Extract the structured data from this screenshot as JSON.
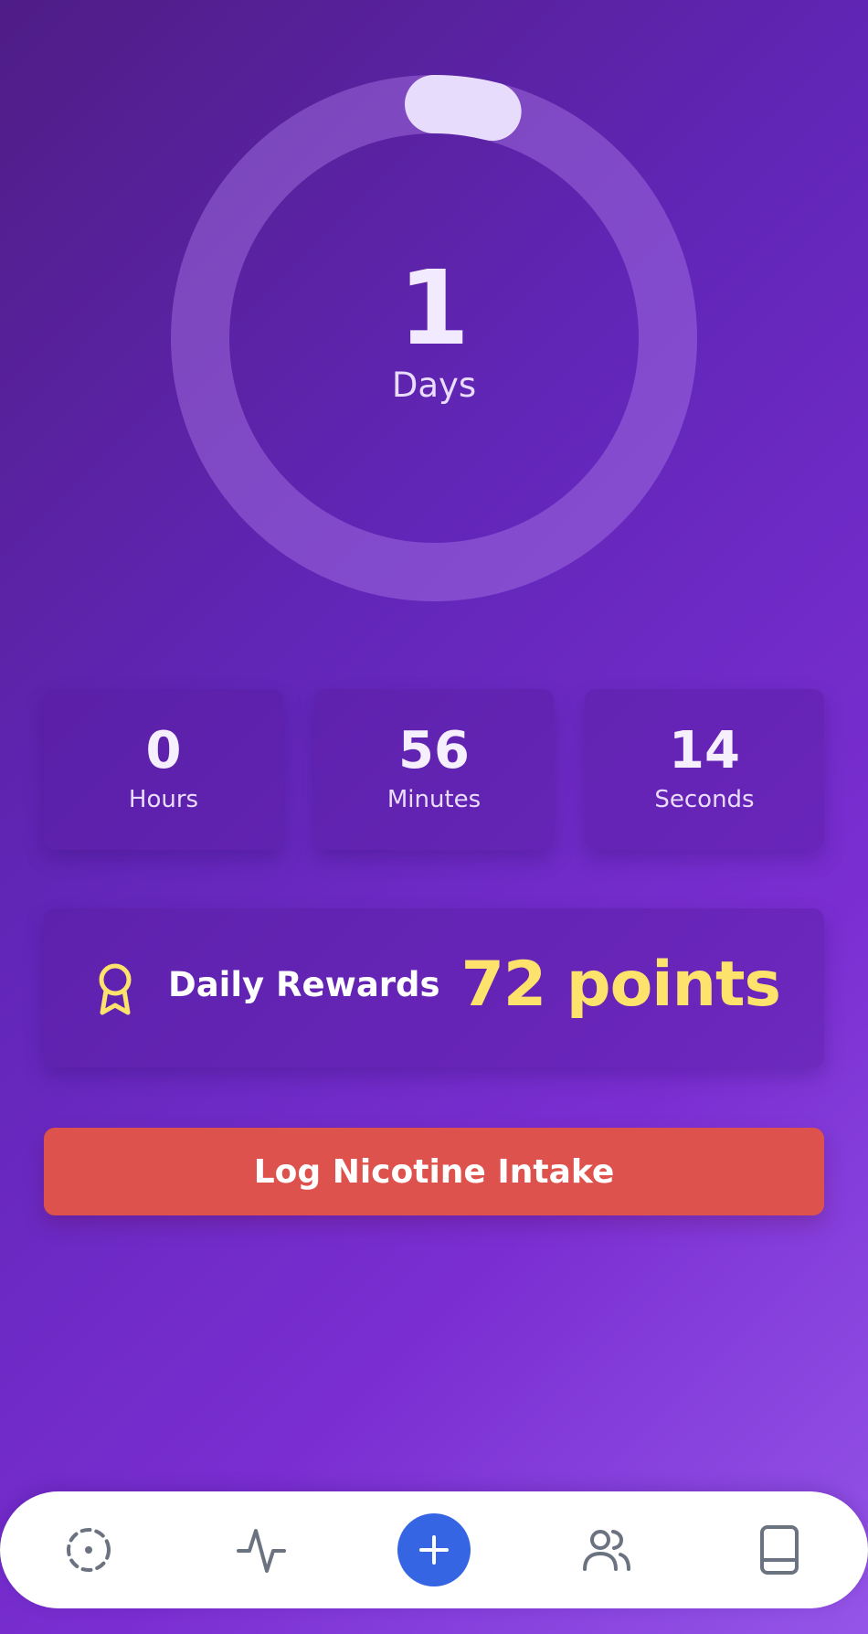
{
  "counter": {
    "days_value": "1",
    "days_label": "Days",
    "day_progress": 0.04
  },
  "stats": [
    {
      "value": "0",
      "label": "Hours"
    },
    {
      "value": "56",
      "label": "Minutes"
    },
    {
      "value": "14",
      "label": "Seconds"
    }
  ],
  "rewards": {
    "icon": "award-icon",
    "label": "Daily Rewards",
    "points": "72 points"
  },
  "log_button": {
    "label": "Log Nicotine Intake"
  },
  "bottom_nav": {
    "items": [
      {
        "icon": "dashed-circle-icon"
      },
      {
        "icon": "activity-icon"
      },
      {
        "icon": "plus-icon"
      },
      {
        "icon": "users-icon"
      },
      {
        "icon": "book-icon"
      }
    ]
  },
  "colors": {
    "accent_yellow": "#fde36b",
    "log_button_red": "#de524d",
    "nav_add_blue": "#3565e3",
    "ring_track": "#8a55d0",
    "ring_progress": "#e8dcfd",
    "nav_icon_gray": "#6b7280"
  }
}
